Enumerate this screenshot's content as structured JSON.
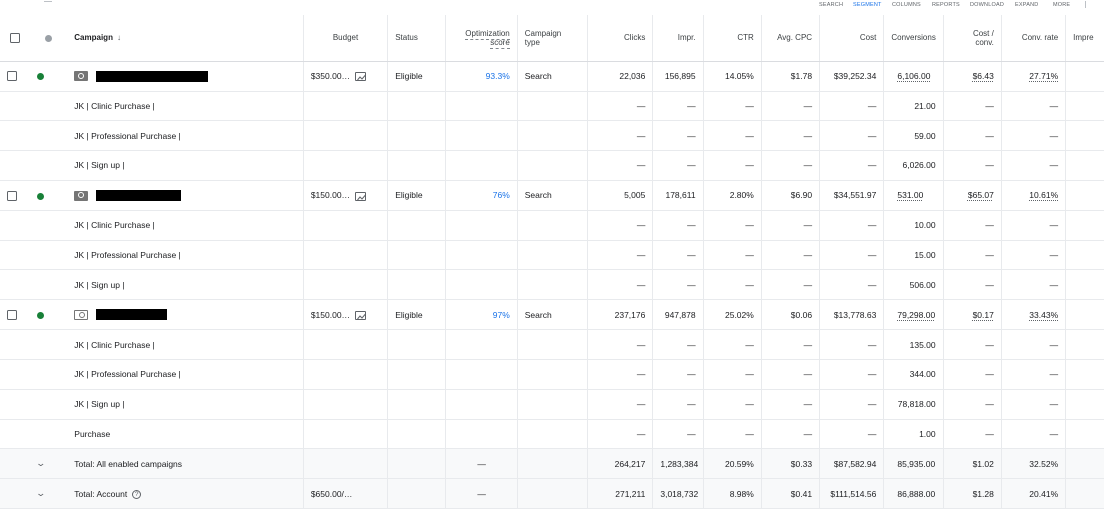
{
  "toolbar": {
    "search": "SEARCH",
    "segment": "SEGMENT",
    "columns": "COLUMNS",
    "reports": "REPORTS",
    "download": "DOWNLOAD",
    "expand": "EXPAND",
    "more": "MORE"
  },
  "headers": {
    "campaign": "Campaign",
    "sort_icon": "↓",
    "budget": "Budget",
    "status": "Status",
    "opt_line1": "Optimization",
    "opt_line2": "score",
    "ctype_line1": "Campaign",
    "ctype_line2": "type",
    "clicks": "Clicks",
    "impr": "Impr.",
    "ctr": "CTR",
    "avg_cpc": "Avg. CPC",
    "cost": "Cost",
    "conversions": "Conversions",
    "cpc_line1": "Cost /",
    "cpc_line2": "conv.",
    "conv_rate": "Conv. rate",
    "impr_share": "Impre"
  },
  "dash": "—",
  "campaigns": [
    {
      "budget": "$350.00…",
      "status": "Eligible",
      "opt": "93.3%",
      "type": "Search",
      "clicks": "22,036",
      "impr": "156,895",
      "ctr": "14.05%",
      "cpc": "$1.78",
      "cost": "$39,252.34",
      "conv": "6,106.00",
      "cost_conv": "$6.43",
      "conv_rate": "27.71%",
      "actions": [
        {
          "name": "JK | Clinic Purchase |",
          "conv": "21.00"
        },
        {
          "name": "JK | Professional Purchase |",
          "conv": "59.00"
        },
        {
          "name": "JK | Sign up |",
          "conv": "6,026.00"
        }
      ]
    },
    {
      "budget": "$150.00…",
      "status": "Eligible",
      "opt": "76%",
      "type": "Search",
      "clicks": "5,005",
      "impr": "178,611",
      "ctr": "2.80%",
      "cpc": "$6.90",
      "cost": "$34,551.97",
      "conv": "531.00",
      "cost_conv": "$65.07",
      "conv_rate": "10.61%",
      "actions": [
        {
          "name": "JK | Clinic Purchase |",
          "conv": "10.00"
        },
        {
          "name": "JK | Professional Purchase |",
          "conv": "15.00"
        },
        {
          "name": "JK | Sign up |",
          "conv": "506.00"
        }
      ]
    },
    {
      "budget": "$150.00…",
      "status": "Eligible",
      "opt": "97%",
      "type": "Search",
      "clicks": "237,176",
      "impr": "947,878",
      "ctr": "25.02%",
      "cpc": "$0.06",
      "cost": "$13,778.63",
      "conv": "79,298.00",
      "cost_conv": "$0.17",
      "conv_rate": "33.43%",
      "actions": [
        {
          "name": "JK | Clinic Purchase |",
          "conv": "135.00"
        },
        {
          "name": "JK | Professional Purchase |",
          "conv": "344.00"
        },
        {
          "name": "JK | Sign up |",
          "conv": "78,818.00"
        },
        {
          "name": "Purchase",
          "conv": "1.00"
        }
      ]
    }
  ],
  "totals": [
    {
      "label": "Total: All enabled campaigns",
      "budget": "",
      "opt": "—",
      "clicks": "264,217",
      "impr": "1,283,384",
      "ctr": "20.59%",
      "cpc": "$0.33",
      "cost": "$87,582.94",
      "conv": "85,935.00",
      "cost_conv": "$1.02",
      "conv_rate": "32.52%"
    },
    {
      "label": "Total: Account",
      "budget": "$650.00/…",
      "opt": "—",
      "clicks": "271,211",
      "impr": "3,018,732",
      "ctr": "8.98%",
      "cpc": "$0.41",
      "cost": "$111,514.56",
      "conv": "86,888.00",
      "cost_conv": "$1.28",
      "conv_rate": "20.41%"
    }
  ],
  "colors": {
    "accent": "#1a73e8",
    "enabled": "#188038",
    "paused": "#9aa0a6"
  },
  "icons": [
    "search-campaign-icon",
    "chart-icon",
    "sort-down-icon",
    "chevron-down-icon",
    "help-icon",
    "checkbox"
  ]
}
